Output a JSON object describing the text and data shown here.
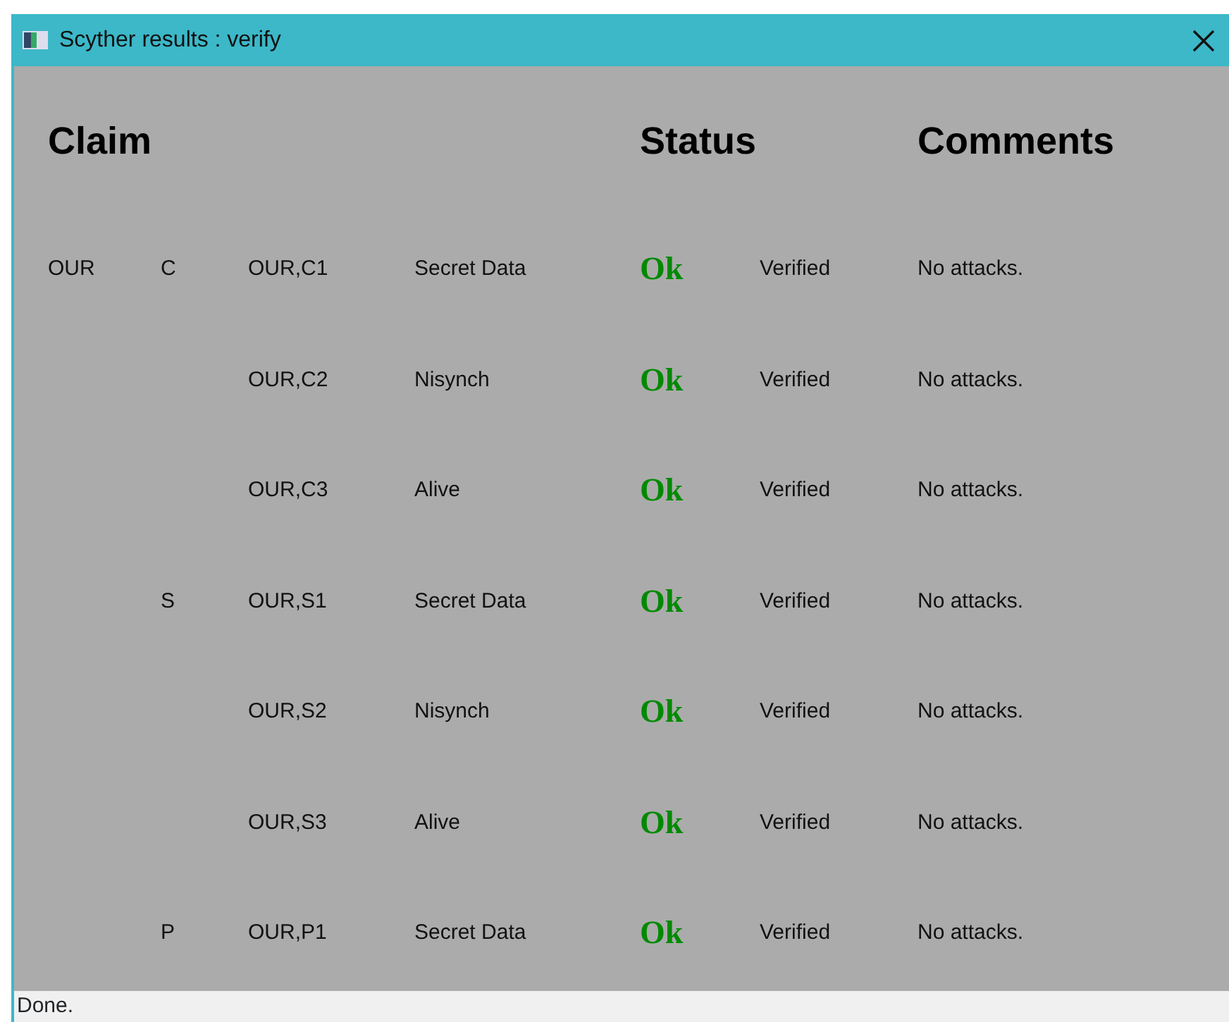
{
  "window": {
    "title": "Scyther results : verify"
  },
  "headers": [
    "Claim",
    "Status",
    "Comments"
  ],
  "rows": [
    {
      "protocol": "OUR",
      "role": "C",
      "claim": "OUR,C1",
      "type": "Secret Data",
      "status": "Ok",
      "result": "Verified",
      "comment": "No attacks."
    },
    {
      "claim": "OUR,C2",
      "type": "Nisynch",
      "status": "Ok",
      "result": "Verified",
      "comment": "No attacks."
    },
    {
      "claim": "OUR,C3",
      "type": "Alive",
      "status": "Ok",
      "result": "Verified",
      "comment": "No attacks."
    },
    {
      "role": "S",
      "claim": "OUR,S1",
      "type": "Secret Data",
      "status": "Ok",
      "result": "Verified",
      "comment": "No attacks."
    },
    {
      "claim": "OUR,S2",
      "type": "Nisynch",
      "status": "Ok",
      "result": "Verified",
      "comment": "No attacks."
    },
    {
      "claim": "OUR,S3",
      "type": "Alive",
      "status": "Ok",
      "result": "Verified",
      "comment": "No attacks."
    },
    {
      "role": "P",
      "claim": "OUR,P1",
      "type": "Secret Data",
      "status": "Ok",
      "result": "Verified",
      "comment": "No attacks."
    }
  ],
  "status_bar": "Done."
}
